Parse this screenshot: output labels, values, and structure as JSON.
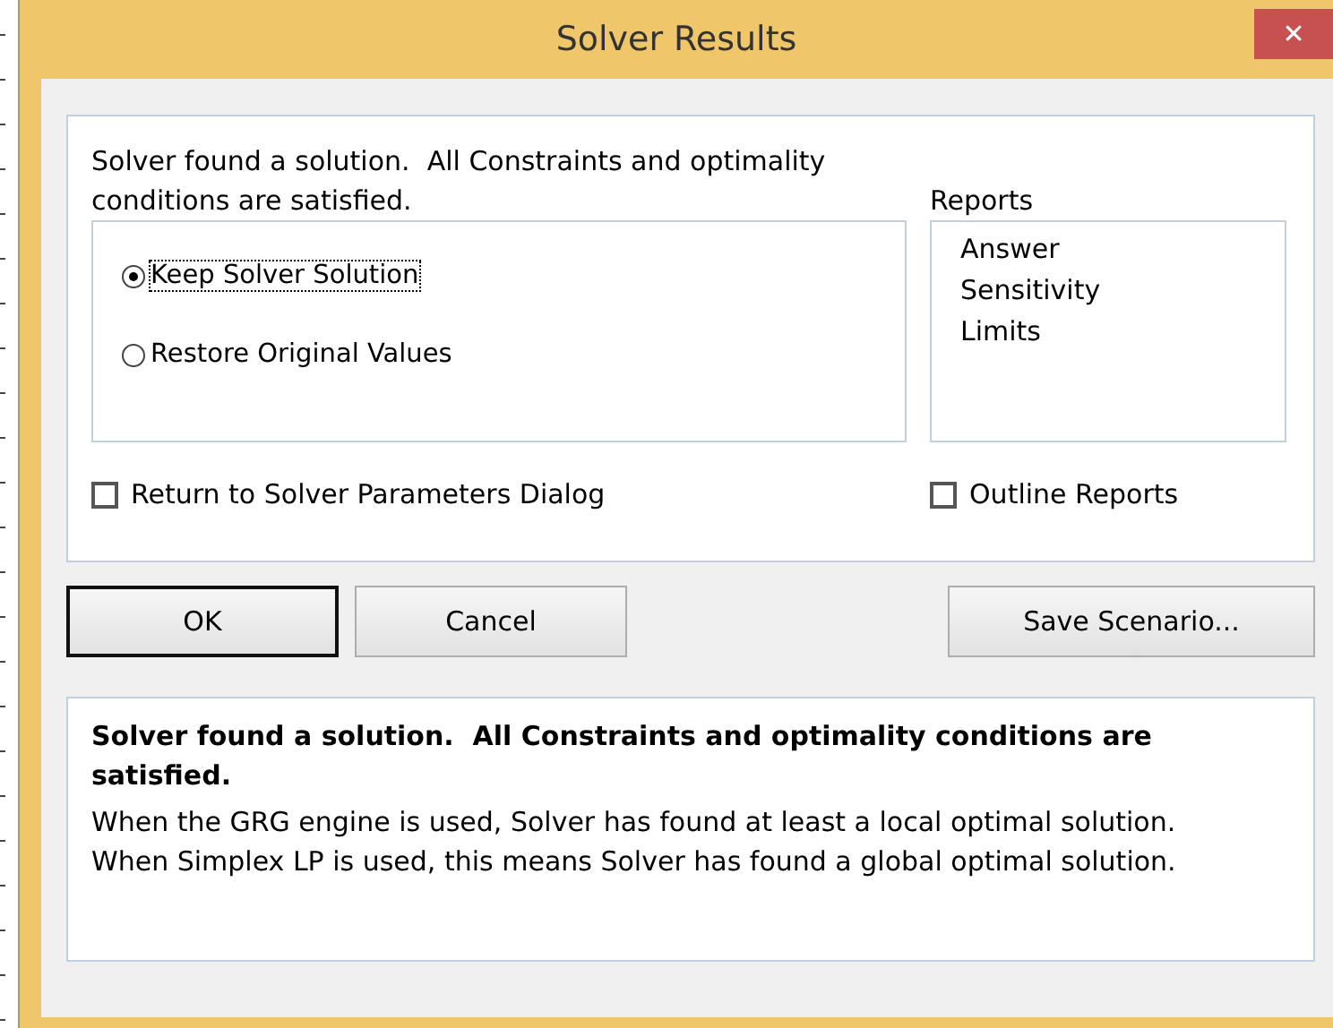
{
  "window": {
    "title": "Solver Results",
    "close": "✕"
  },
  "message": "Solver found a solution.  All Constraints and optimality conditions are satisfied.",
  "options": [
    {
      "label": "Keep Solver Solution",
      "selected": true,
      "focused": true
    },
    {
      "label": "Restore Original Values",
      "selected": false,
      "focused": false
    }
  ],
  "reports": {
    "label": "Reports",
    "items": [
      "Answer",
      "Sensitivity",
      "Limits"
    ]
  },
  "checkboxes": [
    {
      "label": "Return to Solver Parameters Dialog",
      "checked": false
    },
    {
      "label": "Outline Reports",
      "checked": false
    }
  ],
  "buttons": [
    {
      "label": "OK",
      "default": true
    },
    {
      "label": "Cancel",
      "default": false
    },
    {
      "label": "Save Scenario...",
      "default": false
    }
  ],
  "info": {
    "heading": "Solver found a solution.  All Constraints and optimality conditions are satisfied.",
    "body": "When the GRG engine is used, Solver has found at least a local optimal solution. When Simplex LP is used, this means Solver has found a global optimal solution."
  }
}
